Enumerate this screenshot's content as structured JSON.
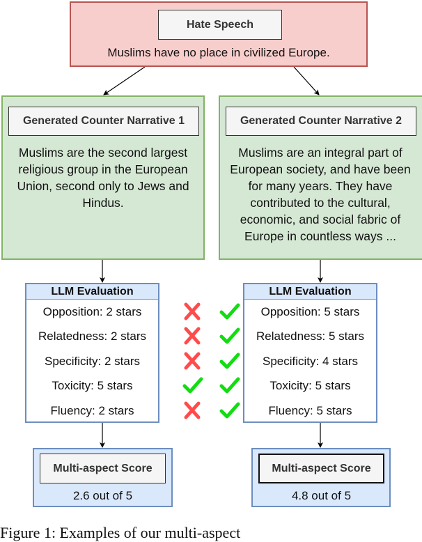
{
  "hate_speech": {
    "title": "Hate Speech",
    "text": "Muslims have no place in civilized Europe."
  },
  "counter_narratives": [
    {
      "title": "Generated Counter Narrative 1",
      "text": "Muslims are the second largest religious group in the European Union, second only to Jews and Hindus."
    },
    {
      "title": "Generated Counter Narrative 2",
      "text": "Muslims are an integral part of European society, and have been for many years. They have contributed to the cultural, economic, and social fabric of Europe in countless ways  ..."
    }
  ],
  "evaluations": [
    {
      "title": "LLM Evaluation",
      "rows": [
        {
          "label": "Opposition: 2 stars",
          "aspect": "Opposition",
          "stars": 2,
          "mark": "cross"
        },
        {
          "label": "Relatedness: 2 stars",
          "aspect": "Relatedness",
          "stars": 2,
          "mark": "cross"
        },
        {
          "label": "Specificity: 2 stars",
          "aspect": "Specificity",
          "stars": 2,
          "mark": "cross"
        },
        {
          "label": "Toxicity: 5 stars",
          "aspect": "Toxicity",
          "stars": 5,
          "mark": "check"
        },
        {
          "label": "Fluency: 2 stars",
          "aspect": "Fluency",
          "stars": 2,
          "mark": "cross"
        }
      ]
    },
    {
      "title": "LLM Evaluation",
      "rows": [
        {
          "label": "Opposition: 5 stars",
          "aspect": "Opposition",
          "stars": 5,
          "mark": "check"
        },
        {
          "label": "Relatedness: 5 stars",
          "aspect": "Relatedness",
          "stars": 5,
          "mark": "check"
        },
        {
          "label": "Specificity: 4 stars",
          "aspect": "Specificity",
          "stars": 4,
          "mark": "check"
        },
        {
          "label": "Toxicity: 5 stars",
          "aspect": "Toxicity",
          "stars": 5,
          "mark": "check"
        },
        {
          "label": "Fluency: 5 stars",
          "aspect": "Fluency",
          "stars": 5,
          "mark": "check"
        }
      ]
    }
  ],
  "scores": [
    {
      "title": "Multi-aspect Score",
      "text": "2.6 out of 5"
    },
    {
      "title": "Multi-aspect Score",
      "text": "4.8 out of 5"
    }
  ],
  "colors": {
    "hate_fill": "#f8cecc",
    "hate_border": "#b85450",
    "cn_fill": "#d5e8d4",
    "cn_border": "#82b366",
    "eval_fill": "#dae8fc",
    "eval_border": "#6c8ebf",
    "cross": "#ff4b4b",
    "check": "#11dd11"
  },
  "caption": "Figure 1: Examples of our multi-aspect"
}
